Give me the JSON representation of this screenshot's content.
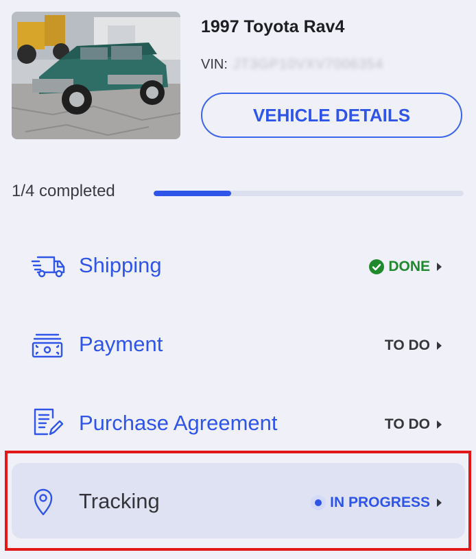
{
  "vehicle": {
    "title": "1997 Toyota Rav4",
    "vin_label": "VIN:",
    "vin_value": "JT3GP10VXV7006354",
    "details_button": "VEHICLE DETAILS"
  },
  "progress": {
    "label": "1/4 completed",
    "fraction": 0.25
  },
  "steps": [
    {
      "label": "Shipping",
      "icon": "truck-icon",
      "status": "DONE"
    },
    {
      "label": "Payment",
      "icon": "cash-icon",
      "status": "TO DO"
    },
    {
      "label": "Purchase Agreement",
      "icon": "document-edit-icon",
      "status": "TO DO"
    },
    {
      "label": "Tracking",
      "icon": "location-pin-icon",
      "status": "IN PROGRESS"
    }
  ],
  "colors": {
    "accent": "#2f55e8",
    "done": "#1f8a2c",
    "highlight": "#e21818",
    "background": "#eff0f8"
  }
}
